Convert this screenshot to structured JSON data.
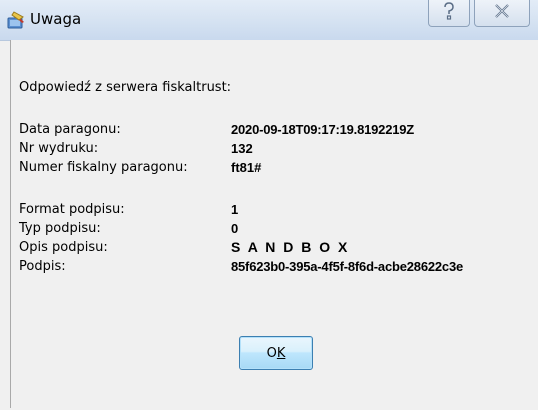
{
  "window": {
    "title": "Uwaga"
  },
  "header": {
    "text": "Odpowiedź z serwera fiskaltrust:"
  },
  "fields": [
    {
      "label": "Data paragonu:",
      "value": "2020-09-18T09:17:19.8192219Z"
    },
    {
      "label": "Nr wydruku:",
      "value": "132"
    },
    {
      "label": "Numer fiskalny paragonu:",
      "value": "ft81#"
    },
    {
      "label": "Format podpisu:",
      "value": "1"
    },
    {
      "label": "Typ podpisu:",
      "value": "0"
    },
    {
      "label": "Opis podpisu:",
      "value": "S A N D B O X"
    },
    {
      "label": "Podpis:",
      "value": "85f623b0-395a-4f5f-8f6d-acbe28622c3e"
    }
  ],
  "ok_button": {
    "label_pre": "O",
    "label_ul": "K"
  },
  "icons": {
    "app": "app-tool-icon",
    "help": "help-icon",
    "close": "close-icon"
  }
}
